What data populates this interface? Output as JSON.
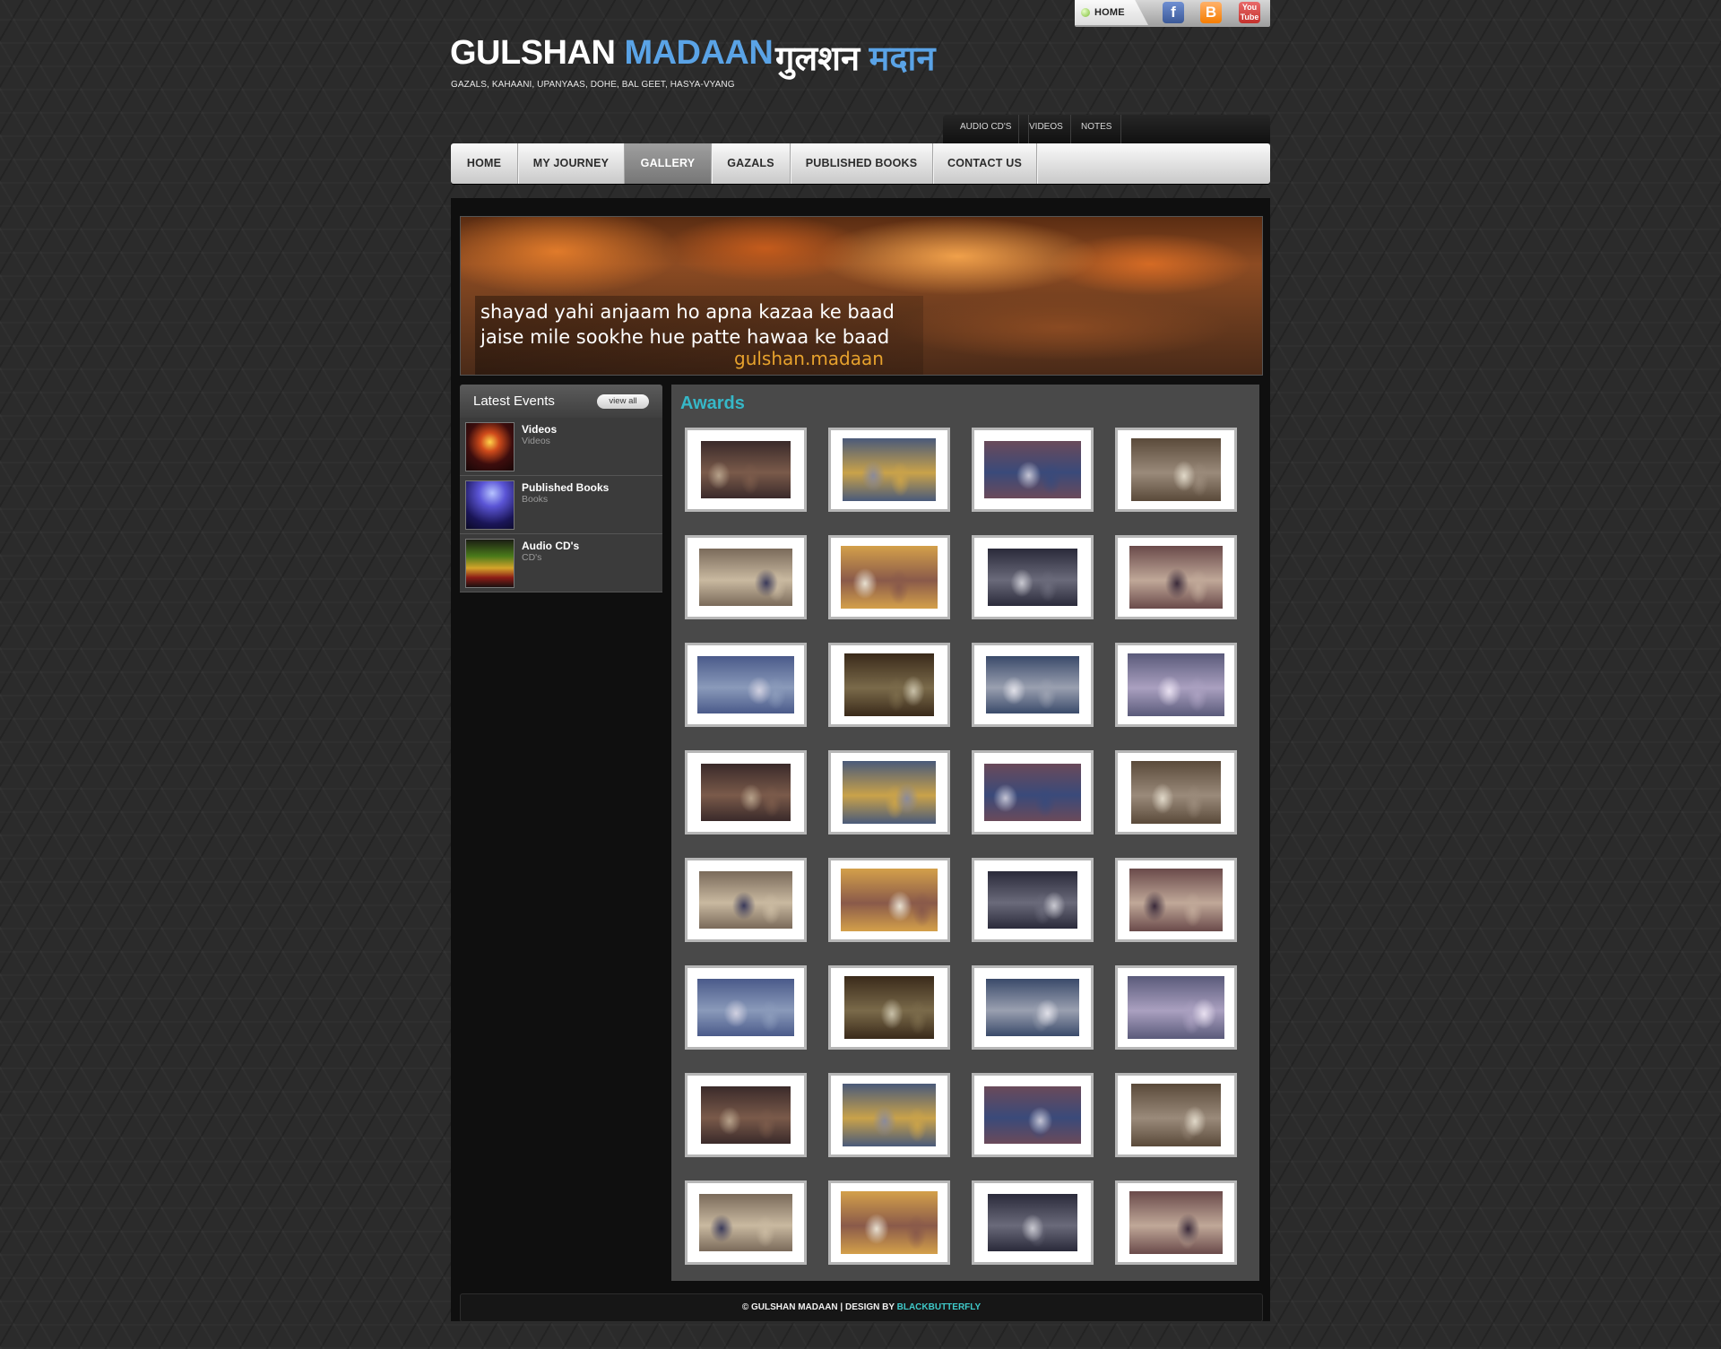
{
  "topbar": {
    "home_label": "HOME",
    "social": [
      "facebook-icon",
      "blogger-icon",
      "youtube-icon"
    ]
  },
  "logo": {
    "name_first": "GULSHAN",
    "name_last": "MADAAN",
    "hindi_first": "गुलशन",
    "hindi_last": "मदान",
    "tagline": "GAZALS, KAHAANI, UPANYAAS, DOHE, BAL GEET, HASYA-VYANG"
  },
  "subnav": [
    "AUDIO CD'S",
    "VIDEOS",
    "NOTES"
  ],
  "mainnav": {
    "items": [
      "HOME",
      "MY JOURNEY",
      "GALLERY",
      "GAZALS",
      "PUBLISHED BOOKS",
      "CONTACT US"
    ],
    "active": "GALLERY"
  },
  "banner": {
    "line1": "shayad yahi anjaam ho apna kazaa ke baad",
    "line2": "jaise mile sookhe hue patte hawaa ke baad",
    "signature": "gulshan.madaan"
  },
  "sidebar": {
    "title": "Latest Events",
    "view_all": "view all",
    "items": [
      {
        "title": "Videos",
        "sub": "Videos"
      },
      {
        "title": "Published Books",
        "sub": "Books"
      },
      {
        "title": "Audio CD's",
        "sub": "CD's"
      }
    ]
  },
  "gallery": {
    "title": "Awards",
    "photo_count": 32
  },
  "footer": {
    "text": "© GULSHAN MADAAN | DESIGN BY ",
    "brand": "BLACKBUTTERFLY"
  },
  "colors": {
    "accent": "#36b8c8",
    "logo_blue": "#5aa3e6",
    "nav_active": "#8a8a8a",
    "background": "#2b2b2b"
  }
}
